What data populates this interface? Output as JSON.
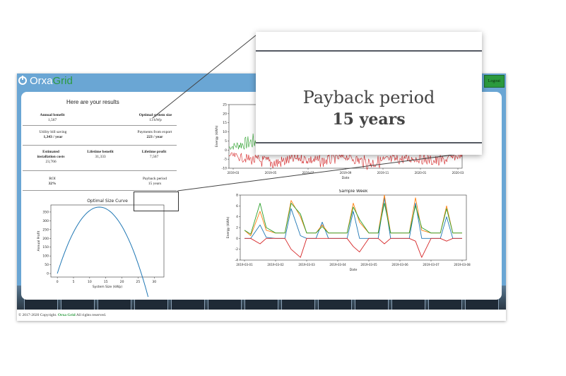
{
  "app": {
    "logo": {
      "part1": "Orxa",
      "part2": "Grid"
    },
    "logout_label": "Logout",
    "colors": {
      "sky": "#6aa6d4",
      "brand_green": "#2b9a3e"
    }
  },
  "results": {
    "title": "Here are your results",
    "annual_benefit": {
      "label": "Annual benefit",
      "value": "1,567"
    },
    "optimal_system_size": {
      "label": "Optimal system size",
      "value": "13 kWp"
    },
    "utility_bill_saving": {
      "label": "Utility bill saving",
      "value": "1,343 / year"
    },
    "payments_from_export": {
      "label": "Payments from export",
      "value": "223 / year"
    },
    "estimated_installation_costs": {
      "label_line1": "Estimated",
      "label_line2": "installation costs",
      "value": "23,766"
    },
    "lifetime_benefit": {
      "label": "Lifetime benefit",
      "value": "31,333"
    },
    "lifetime_profit": {
      "label": "Lifetime profit",
      "value": "7,567"
    },
    "roi": {
      "label": "ROI",
      "value": "32%"
    },
    "payback_period": {
      "label": "Payback period",
      "value": "15 years"
    }
  },
  "footer": {
    "prefix": "© 2017-2020 Copyright.",
    "brand": "Orxa Grid",
    "suffix": "All rights reserved."
  },
  "zoom": {
    "label": "Payback period",
    "value": "15 years"
  },
  "chart_data": [
    {
      "type": "line",
      "title": "Optimal Size Curve",
      "xlabel": "System Size (kWp)",
      "ylabel": "Annual Profit",
      "x": [
        0,
        2,
        4,
        6,
        8,
        10,
        12,
        13,
        14,
        16,
        18,
        20,
        22,
        24,
        26,
        28,
        30,
        32
      ],
      "series": [
        {
          "color": "#1f77b4",
          "values": [
            0,
            99,
            185,
            256,
            313,
            352,
            375,
            378,
            375,
            352,
            313,
            256,
            185,
            99,
            0,
            -20,
            -40,
            -60
          ]
        }
      ],
      "xticks": [
        "0",
        "5",
        "10",
        "15",
        "20",
        "25",
        "30"
      ],
      "yticks": [
        "0",
        "50",
        "100",
        "150",
        "200",
        "250",
        "300",
        "350"
      ],
      "xlim": [
        -2,
        33
      ],
      "ylim": [
        -20,
        390
      ]
    },
    {
      "type": "line",
      "title": "",
      "xlabel": "Date",
      "ylabel": "Energy (kWh)",
      "xticks": [
        "2019-03",
        "2019-05",
        "2019-07",
        "2019-09",
        "2019-11",
        "2020-01",
        "2020-03"
      ],
      "yticks": [
        "-10",
        "-5",
        "0",
        "5",
        "10",
        "15",
        "20",
        "25"
      ],
      "ylim": [
        -10,
        25
      ],
      "series": [
        {
          "color": "#2ca02c",
          "values": [
            3,
            9,
            14,
            18,
            12,
            16,
            9,
            13,
            7,
            10,
            4
          ]
        },
        {
          "color": "#d62728",
          "values": [
            -3,
            -6,
            -8,
            -5,
            -7,
            -4,
            -8,
            -6,
            -5,
            -7,
            -3
          ]
        }
      ]
    },
    {
      "type": "line",
      "title": "Sample Week",
      "xlabel": "Date",
      "ylabel": "Energy (kWh)",
      "xticks": [
        "2019-03-01",
        "2019-03-02",
        "2019-03-03",
        "2019-03-04",
        "2019-03-05",
        "2019-03-06",
        "2019-03-07",
        "2019-03-08"
      ],
      "yticks": [
        "-4",
        "-2",
        "0",
        "2",
        "4",
        "6",
        "8"
      ],
      "ylim": [
        -4,
        8
      ],
      "x": [
        0,
        0.2,
        0.5,
        0.7,
        1.0,
        1.3,
        1.5,
        1.8,
        2.0,
        2.3,
        2.5,
        2.7,
        3.0,
        3.3,
        3.5,
        3.7,
        4.0,
        4.3,
        4.5,
        4.7,
        5.0,
        5.3,
        5.5,
        5.7,
        6.0,
        6.3,
        6.5,
        6.7,
        7.0
      ],
      "series": [
        {
          "color": "#1f77b4",
          "values": [
            0,
            0,
            2.5,
            0.2,
            0,
            0,
            5.5,
            0.5,
            0,
            0,
            3,
            0,
            0,
            0,
            5,
            0,
            0,
            0,
            7.5,
            0,
            0,
            0,
            6.5,
            0,
            0,
            0,
            4,
            0,
            0
          ]
        },
        {
          "color": "#ff7f0e",
          "values": [
            1.5,
            0.5,
            5,
            1.5,
            1,
            1,
            7,
            4,
            1,
            1,
            2.5,
            1,
            1,
            1,
            6.5,
            3,
            1,
            1,
            8,
            1,
            1,
            1,
            7.5,
            1.5,
            1,
            1,
            6,
            1,
            1
          ]
        },
        {
          "color": "#2ca02c",
          "values": [
            1.5,
            0.8,
            6.5,
            2,
            1,
            1,
            6.5,
            4.5,
            1,
            1,
            2.2,
            1,
            1,
            1,
            5.8,
            3.5,
            1,
            1,
            6.5,
            1,
            1,
            1,
            6,
            2,
            1,
            1,
            5.5,
            1,
            1
          ]
        },
        {
          "color": "#d62728",
          "values": [
            0,
            0,
            -1,
            0,
            0,
            0,
            -2,
            -3.5,
            0,
            0,
            0,
            0,
            0,
            0,
            -1.5,
            -2.5,
            0,
            0,
            -1,
            0,
            0,
            0,
            -0.5,
            -3.5,
            0,
            0,
            -0.5,
            0,
            0
          ]
        }
      ]
    }
  ]
}
